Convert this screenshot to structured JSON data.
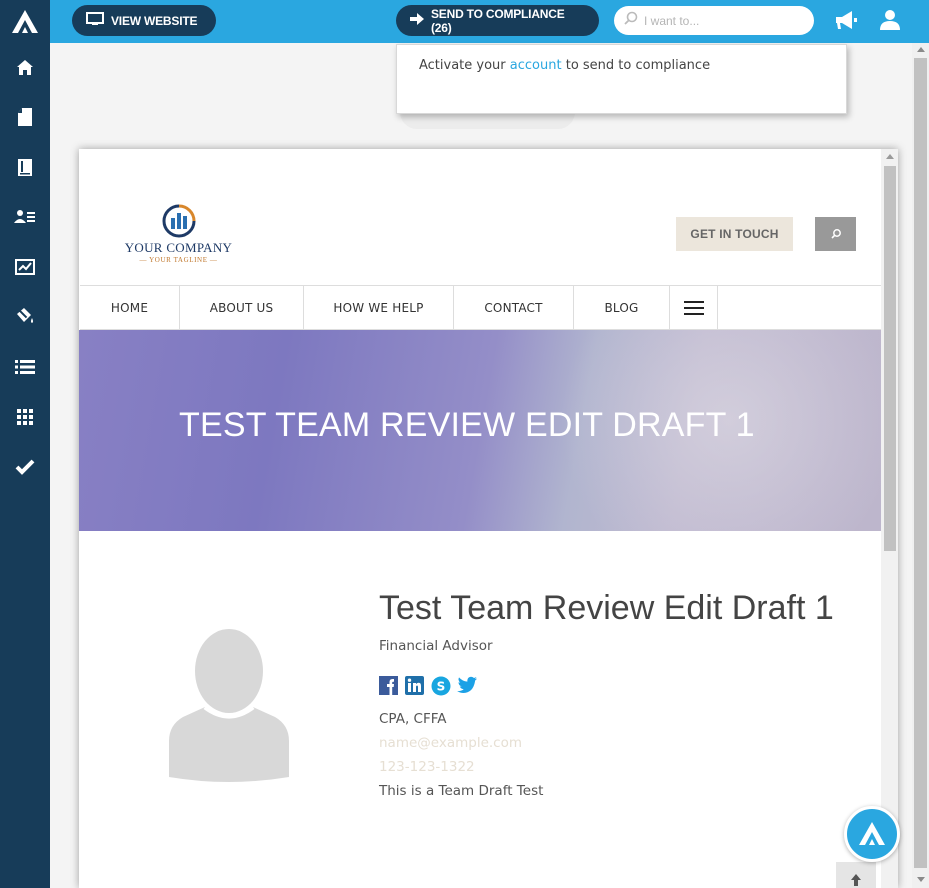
{
  "topbar": {
    "view_website_label": "VIEW WEBSITE",
    "send_compliance_label": "SEND TO COMPLIANCE (26)",
    "search_placeholder": "I want to...",
    "accent_color": "#2aa7e0",
    "dark_color": "#173c59"
  },
  "sidebar": {
    "items": [
      {
        "icon": "home-icon"
      },
      {
        "icon": "pages-icon"
      },
      {
        "icon": "book-icon"
      },
      {
        "icon": "contacts-icon"
      },
      {
        "icon": "analytics-icon"
      },
      {
        "icon": "paint-bucket-icon"
      },
      {
        "icon": "list-icon"
      },
      {
        "icon": "apps-grid-icon"
      },
      {
        "icon": "checkmark-icon"
      }
    ]
  },
  "popup": {
    "prefix": "Activate your",
    "link": "account",
    "suffix": "to send to compliance"
  },
  "site": {
    "company_name": "YOUR COMPANY",
    "tagline": "YOUR TAGLINE",
    "get_in_touch": "GET IN TOUCH",
    "nav": [
      "HOME",
      "ABOUT US",
      "HOW WE HELP",
      "CONTACT",
      "BLOG"
    ],
    "hero_title": "TEST TEAM REVIEW EDIT DRAFT 1",
    "profile": {
      "name": "Test Team Review Edit Draft 1",
      "title": "Financial Advisor",
      "credentials": "CPA, CFFA",
      "email": "name@example.com",
      "phone": "123-123-1322",
      "bio": "This is a Team Draft Test",
      "social_icons": [
        "facebook-icon",
        "linkedin-icon",
        "skype-icon",
        "twitter-icon"
      ]
    }
  }
}
